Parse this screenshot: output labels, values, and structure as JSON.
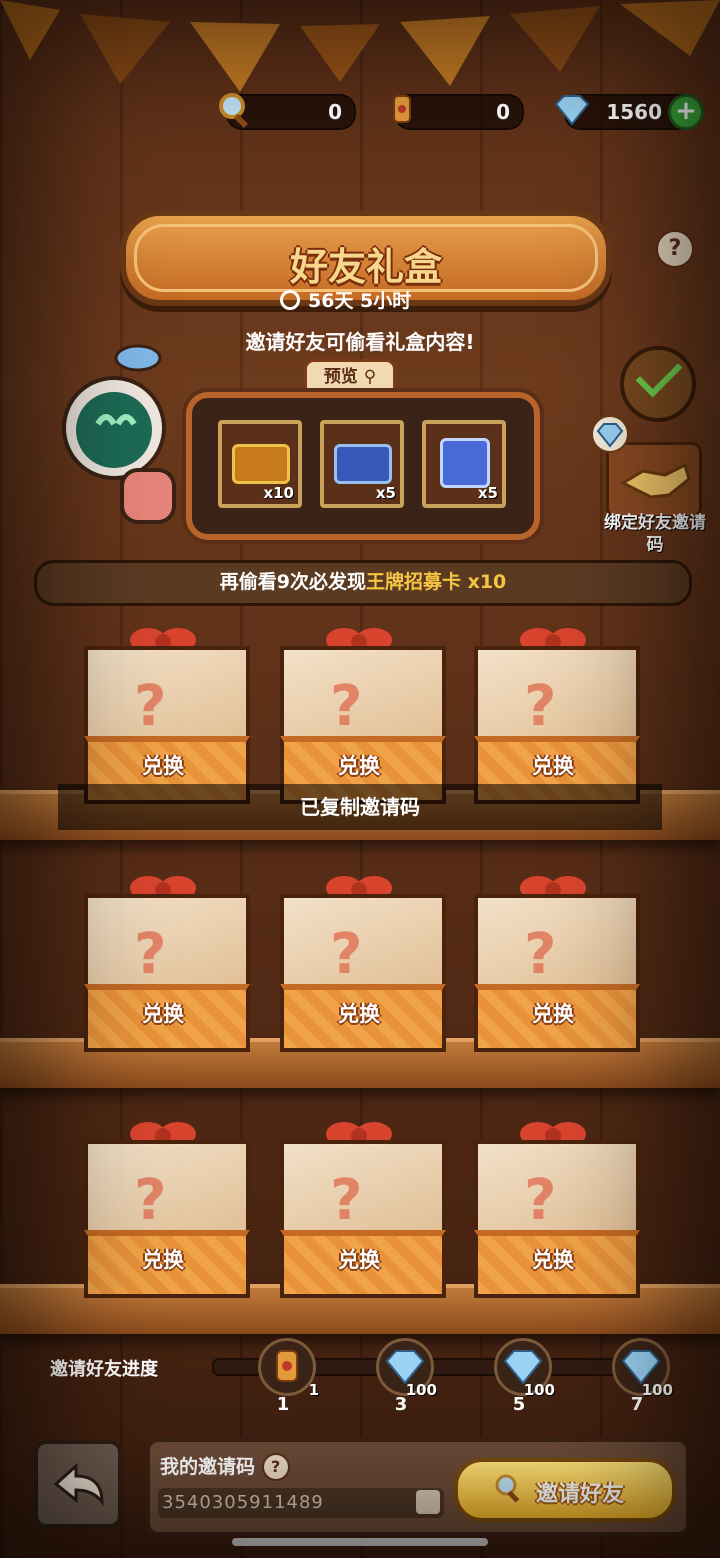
{
  "currency": {
    "magnifier": {
      "icon": "magnifier-icon",
      "value": "0"
    },
    "scroll": {
      "icon": "scroll-icon",
      "value": "0"
    },
    "diamond": {
      "icon": "diamond-icon",
      "value": "1560"
    }
  },
  "title": "好友礼盒",
  "timer": "56天 5小时",
  "hint": "邀请好友可偷看礼盒内容!",
  "preview": {
    "tab_label": "预览",
    "items": [
      {
        "icon": "ticket-gold-icon",
        "count": "x10"
      },
      {
        "icon": "ticket-blue-icon",
        "count": "x5"
      },
      {
        "icon": "crystal-cube-icon",
        "count": "x5"
      }
    ]
  },
  "bind_label": "绑定好友邀请码",
  "banner": {
    "prefix": "再偷看9次必发现",
    "highlight": "王牌招募卡",
    "suffix": " x10"
  },
  "boxes": {
    "label": "兑换",
    "rows": [
      [
        "兑换",
        "兑换",
        "兑换"
      ],
      [
        "兑换",
        "兑换",
        "兑换"
      ],
      [
        "兑换",
        "兑换",
        "兑换"
      ]
    ]
  },
  "toast": "已复制邀请码",
  "progress": {
    "label": "邀请好友进度",
    "nodes": [
      {
        "icon": "scroll-icon",
        "amount": "1",
        "step": "1"
      },
      {
        "icon": "diamond-icon",
        "amount": "100",
        "step": "3"
      },
      {
        "icon": "diamond-icon",
        "amount": "100",
        "step": "5"
      },
      {
        "icon": "diamond-icon",
        "amount": "100",
        "step": "7"
      }
    ]
  },
  "invite": {
    "title": "我的邀请码",
    "code": "3540305911489",
    "button": "邀请好友"
  },
  "colors": {
    "accent": "#f5c542",
    "wood": "#5a2e17",
    "box_base": "#f0a348"
  }
}
